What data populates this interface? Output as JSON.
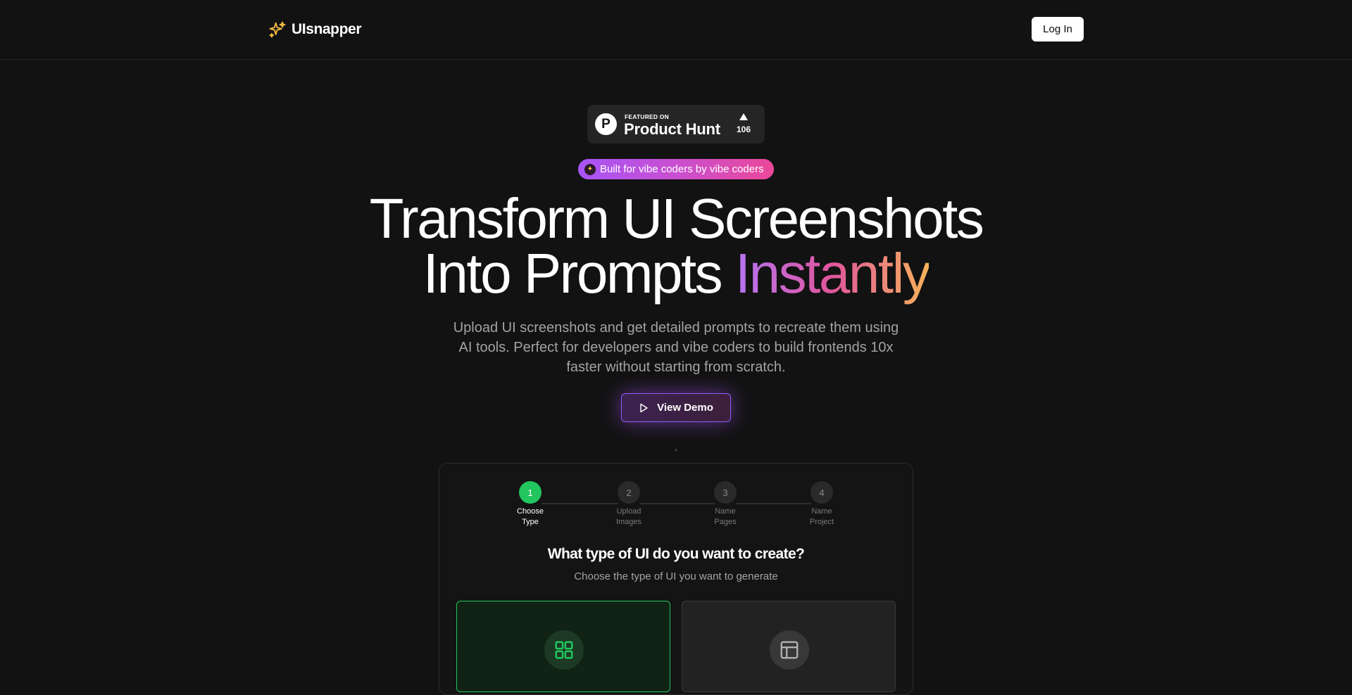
{
  "header": {
    "logo_icon": "sparkles-icon",
    "logo_text": "UIsnapper",
    "login_label": "Log In"
  },
  "product_hunt": {
    "featured_label": "FEATURED ON",
    "name": "Product Hunt",
    "logo_letter": "P",
    "upvotes": "106"
  },
  "pill": {
    "icon": "sparkle-badge-icon",
    "text": "Built for vibe coders by vibe coders"
  },
  "hero": {
    "title_line1": "Transform UI Screenshots",
    "title_line2_plain": "Into Prompts ",
    "title_line2_gradient": "Instantly",
    "subtitle": "Upload UI screenshots and get detailed prompts to recreate them using AI tools. Perfect for developers and vibe coders to build frontends 10x faster without starting from scratch.",
    "demo_label": "View Demo"
  },
  "wizard": {
    "steps": [
      {
        "number": "1",
        "line1": "Choose",
        "line2": "Type",
        "active": true
      },
      {
        "number": "2",
        "line1": "Upload",
        "line2": "Images",
        "active": false
      },
      {
        "number": "3",
        "line1": "Name",
        "line2": "Pages",
        "active": false
      },
      {
        "number": "4",
        "line1": "Name",
        "line2": "Project",
        "active": false
      }
    ],
    "title": "What type of UI do you want to create?",
    "subtitle": "Choose the type of UI you want to generate",
    "options": [
      {
        "icon": "grid-icon",
        "selected": true
      },
      {
        "icon": "layout-icon",
        "selected": false
      }
    ]
  },
  "colors": {
    "background": "#121212",
    "accent_green": "#22c55e",
    "accent_purple": "#a855f7",
    "accent_pink": "#ec4899",
    "accent_orange": "#f7b35a",
    "logo_gold": "#f5b942"
  }
}
